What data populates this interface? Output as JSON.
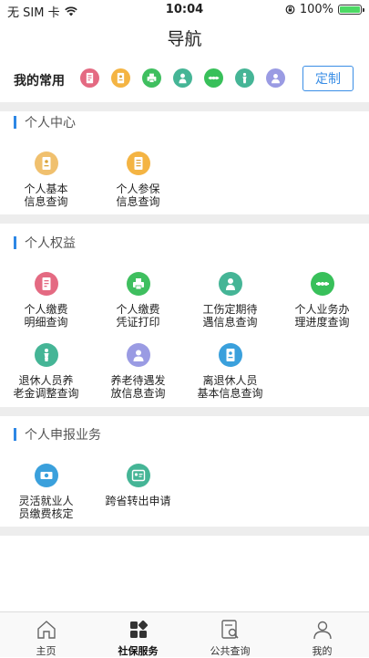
{
  "status_bar": {
    "carrier": "无 SIM 卡",
    "time": "10:04",
    "battery": "100%",
    "battery_level": 1.0
  },
  "nav": {
    "title": "导航"
  },
  "favorites": {
    "label": "我的常用",
    "customize_label": "定制",
    "icons": [
      {
        "name": "payment-detail-icon",
        "color": "#e46a82"
      },
      {
        "name": "basic-info-icon",
        "color": "#f4b443"
      },
      {
        "name": "printer-icon",
        "color": "#3fbf5f"
      },
      {
        "name": "injury-icon",
        "color": "#45b596"
      },
      {
        "name": "progress-icon",
        "color": "#38c05a"
      },
      {
        "name": "retiree-icon",
        "color": "#45b596"
      },
      {
        "name": "elderly-icon",
        "color": "#9a9be3"
      }
    ]
  },
  "sections": [
    {
      "title": "个人中心",
      "items": [
        {
          "label": "个人基本\n信息查询",
          "icon": "basic-info-icon",
          "color": "#f0c06e"
        },
        {
          "label": "个人参保\n信息查询",
          "icon": "insurance-info-icon",
          "color": "#f4b443"
        }
      ]
    },
    {
      "title": "个人权益",
      "items": [
        {
          "label": "个人缴费\n明细查询",
          "icon": "payment-detail-icon",
          "color": "#e46a82"
        },
        {
          "label": "个人缴费\n凭证打印",
          "icon": "printer-icon",
          "color": "#3fbf5f"
        },
        {
          "label": "工伤定期待\n遇信息查询",
          "icon": "injury-icon",
          "color": "#45b596"
        },
        {
          "label": "个人业务办\n理进度查询",
          "icon": "progress-icon",
          "color": "#38c05a"
        },
        {
          "label": "退休人员养\n老金调整查询",
          "icon": "retiree-icon",
          "color": "#45b596"
        },
        {
          "label": "养老待遇发\n放信息查询",
          "icon": "elderly-icon",
          "color": "#9a9be3"
        },
        {
          "label": "离退休人员\n基本信息查询",
          "icon": "retired-info-icon",
          "color": "#3aa0dc"
        }
      ]
    },
    {
      "title": "个人申报业务",
      "items": [
        {
          "label": "灵活就业人\n员缴费核定",
          "icon": "money-icon",
          "color": "#3aa0dc"
        },
        {
          "label": "跨省转出申请",
          "icon": "transfer-icon",
          "color": "#45b596"
        }
      ]
    }
  ],
  "tabbar": [
    {
      "label": "主页",
      "icon": "home-icon"
    },
    {
      "label": "社保服务",
      "icon": "grid-icon"
    },
    {
      "label": "公共查询",
      "icon": "search-doc-icon"
    },
    {
      "label": "我的",
      "icon": "user-icon"
    }
  ]
}
